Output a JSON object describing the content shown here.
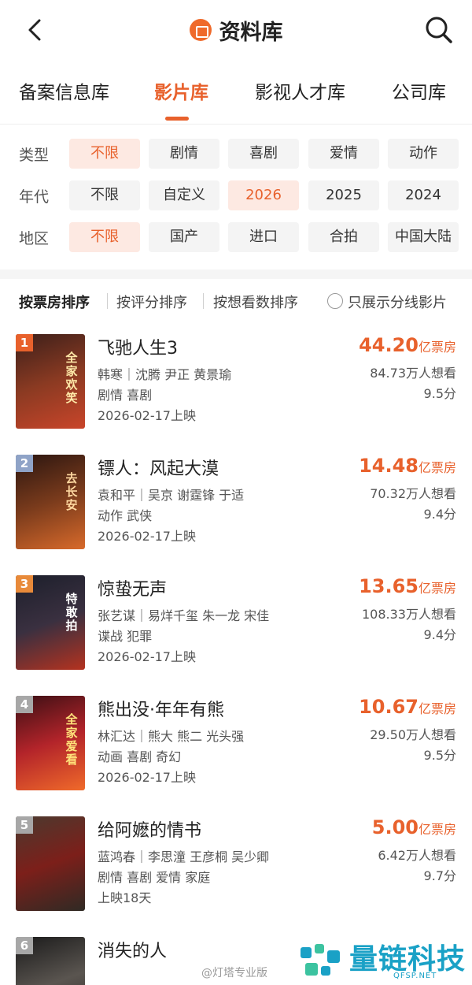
{
  "header": {
    "title": "资料库",
    "back_icon": "chevron-left-icon",
    "search_icon": "search-icon"
  },
  "tabs": [
    {
      "label": "备案信息库",
      "active": false
    },
    {
      "label": "影片库",
      "active": true
    },
    {
      "label": "影视人才库",
      "active": false
    },
    {
      "label": "公司库",
      "active": false
    }
  ],
  "filters": {
    "type": {
      "label": "类型",
      "options": [
        "不限",
        "剧情",
        "喜剧",
        "爱情",
        "动作"
      ],
      "selected": 0
    },
    "year": {
      "label": "年代",
      "options": [
        "不限",
        "自定义",
        "2026",
        "2025",
        "2024"
      ],
      "selected": 2
    },
    "region": {
      "label": "地区",
      "options": [
        "不限",
        "国产",
        "进口",
        "合拍",
        "中国大陆"
      ],
      "selected": 0
    }
  },
  "sort": {
    "options": [
      "按票房排序",
      "按评分排序",
      "按想看数排序"
    ],
    "active": 0,
    "checkbox_label": "只展示分线影片"
  },
  "movies": [
    {
      "rank": "1",
      "name": "飞驰人生3",
      "cast": "韩寒｜沈腾 尹正 黄景瑜",
      "genres": "剧情 喜剧",
      "release": "2026-02-17上映",
      "box": "44.20",
      "box_unit": "亿票房",
      "want": "84.73万人想看",
      "score": "9.5分"
    },
    {
      "rank": "2",
      "name": "镖人：风起大漠",
      "cast": "袁和平｜吴京 谢霆锋 于适",
      "genres": "动作 武侠",
      "release": "2026-02-17上映",
      "box": "14.48",
      "box_unit": "亿票房",
      "want": "70.32万人想看",
      "score": "9.4分"
    },
    {
      "rank": "3",
      "name": "惊蛰无声",
      "cast": "张艺谋｜易烊千玺 朱一龙 宋佳",
      "genres": "谍战 犯罪",
      "release": "2026-02-17上映",
      "box": "13.65",
      "box_unit": "亿票房",
      "want": "108.33万人想看",
      "score": "9.4分"
    },
    {
      "rank": "4",
      "name": "熊出没·年年有熊",
      "cast": "林汇达｜熊大 熊二 光头强",
      "genres": "动画 喜剧 奇幻",
      "release": "2026-02-17上映",
      "box": "10.67",
      "box_unit": "亿票房",
      "want": "29.50万人想看",
      "score": "9.5分"
    },
    {
      "rank": "5",
      "name": "给阿嬷的情书",
      "cast": "蓝鸿春｜李思潼 王彦桐 吴少卿",
      "genres": "剧情 喜剧 爱情 家庭",
      "release": "上映18天",
      "box": "5.00",
      "box_unit": "亿票房",
      "want": "6.42万人想看",
      "score": "9.7分"
    },
    {
      "rank": "6",
      "name": "消失的人"
    }
  ],
  "posters": {
    "1": {
      "text": "全家欢笑",
      "colors": [
        "#3b1f1a",
        "#8a3a22",
        "#c9452a"
      ],
      "text_color": "#ffe9a8"
    },
    "2": {
      "text": "去长安",
      "colors": [
        "#2a1510",
        "#7a3b1c",
        "#d86a2b"
      ],
      "text_color": "#ffd8a0"
    },
    "3": {
      "text": "特敢拍",
      "colors": [
        "#1c1f2b",
        "#3a3040",
        "#b5321f"
      ],
      "text_color": "#ffffff"
    },
    "4": {
      "text": "全家爱看",
      "colors": [
        "#3a0f14",
        "#b3242a",
        "#f06a2a"
      ],
      "text_color": "#ffe27a"
    },
    "5": {
      "text": "",
      "colors": [
        "#4a3a2f",
        "#7c1f1a",
        "#2f2a24"
      ],
      "text_color": "#ffffff"
    },
    "6": {
      "text": "",
      "colors": [
        "#1a1a1a",
        "#5a5550",
        "#2a2522"
      ],
      "text_color": "#ffffff"
    }
  },
  "rank_colors": {
    "1": "#e8612c",
    "2": "#8fa3c7",
    "3": "#e88a3a",
    "4": "#a7a7a7",
    "5": "#a7a7a7",
    "6": "#a7a7a7"
  },
  "watermark": {
    "left": "@灯塔专业版",
    "brand": "量链科技",
    "sub": "QFSP.NET"
  },
  "colors": {
    "accent": "#e8612c",
    "brand_watermark": "#1aa1c6"
  }
}
